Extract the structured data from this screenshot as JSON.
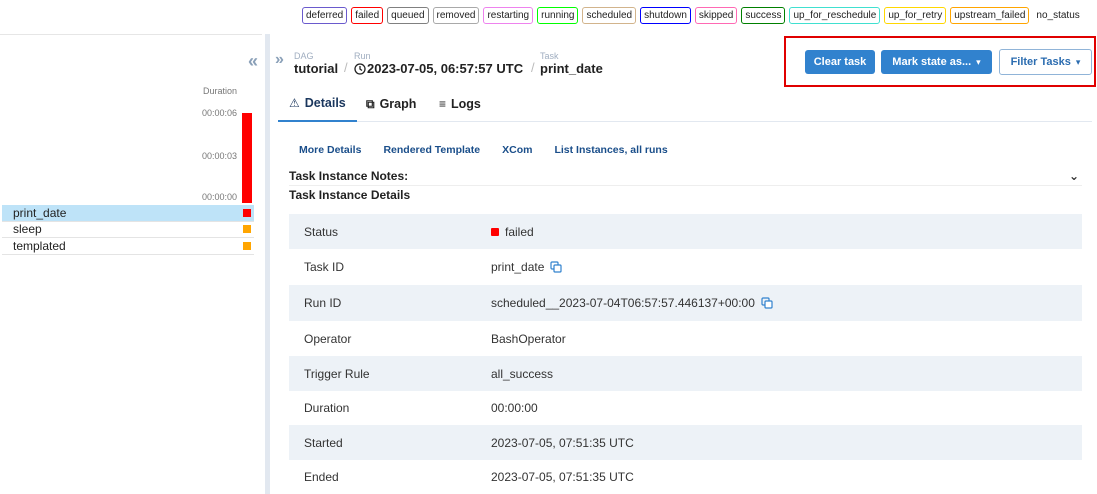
{
  "legend": [
    "deferred",
    "failed",
    "queued",
    "removed",
    "restarting",
    "running",
    "scheduled",
    "shutdown",
    "skipped",
    "success",
    "up_for_reschedule",
    "up_for_retry",
    "upstream_failed"
  ],
  "legend_plain": "no_status",
  "colors": {
    "deferred": "#6a5acd",
    "failed": "#ff0000",
    "queued": "#808080",
    "removed": "#a9a9a9",
    "restarting": "#ee82ee",
    "running": "#00ff00",
    "scheduled": "#d2b48c",
    "shutdown": "#0000ff",
    "skipped": "#ff69b4",
    "success": "#008000",
    "up_for_reschedule": "#40e0d0",
    "up_for_retry": "#ffd700",
    "upstream_failed": "#ffa500",
    "accent": "#3182ce",
    "highlight": "#e00000"
  },
  "left": {
    "collapse_icon": "«",
    "duration_title": "Duration",
    "ticks": [
      "00:00:06",
      "00:00:03",
      "00:00:00"
    ],
    "bar_fraction": 1.0,
    "tasks": [
      {
        "name": "print_date",
        "state": "failed",
        "color": "#ff0000",
        "selected": true
      },
      {
        "name": "sleep",
        "state": "upstream_failed",
        "color": "#ffa500",
        "selected": false
      },
      {
        "name": "templated",
        "state": "upstream_failed",
        "color": "#ffa500",
        "selected": false
      }
    ]
  },
  "breadcrumb": {
    "expand_icon": "»",
    "dag_label": "DAG",
    "dag_value": "tutorial",
    "run_label": "Run",
    "run_value": "2023-07-05, 06:57:57 UTC",
    "task_label": "Task",
    "task_value": "print_date",
    "sep": "/"
  },
  "actions": {
    "clear_task": "Clear task",
    "mark_state": "Mark state as...",
    "filter_tasks": "Filter Tasks",
    "caret": "▾"
  },
  "tabs": [
    {
      "label": "Details",
      "icon": "⚠",
      "icon_name": "warning-icon"
    },
    {
      "label": "Graph",
      "icon": "⧉",
      "icon_name": "graph-icon"
    },
    {
      "label": "Logs",
      "icon": "≡",
      "icon_name": "logs-icon"
    }
  ],
  "sublinks": [
    "More Details",
    "Rendered Template",
    "XCom",
    "List Instances, all runs"
  ],
  "notes_label": "Task Instance Notes:",
  "notes_chevron": "⌄",
  "details_title": "Task Instance Details",
  "details": [
    {
      "key": "Status",
      "value": "failed"
    },
    {
      "key": "Task ID",
      "value": "print_date"
    },
    {
      "key": "Run ID",
      "value": "scheduled__2023-07-04T06:57:57.446137+00:00"
    },
    {
      "key": "Operator",
      "value": "BashOperator"
    },
    {
      "key": "Trigger Rule",
      "value": "all_success"
    },
    {
      "key": "Duration",
      "value": "00:00:00"
    },
    {
      "key": "Started",
      "value": "2023-07-05, 07:51:35 UTC"
    },
    {
      "key": "Ended",
      "value": "2023-07-05, 07:51:35 UTC"
    }
  ]
}
